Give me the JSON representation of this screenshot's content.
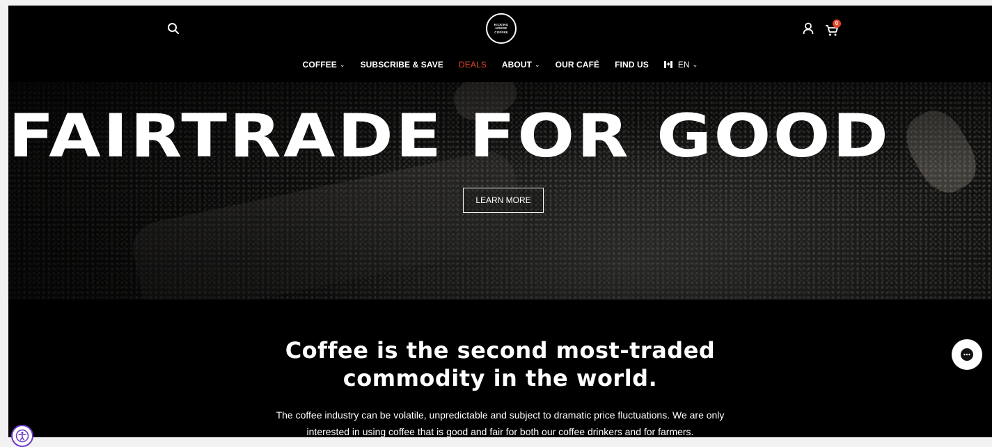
{
  "header": {
    "logo": {
      "line1": "KICKING",
      "line2": "HORSE",
      "line3": "COFFEE"
    },
    "cart_count": "0",
    "nav": {
      "coffee": "COFFEE",
      "subscribe": "SUBSCRIBE & SAVE",
      "deals": "DEALS",
      "about": "ABOUT",
      "cafe": "OUR CAFÉ",
      "find": "FIND US",
      "language": "EN"
    },
    "colors": {
      "accent": "#e8462a",
      "background": "#000000"
    }
  },
  "hero": {
    "title": "FAIRTRADE FOR GOOD",
    "button_label": "LEARN MORE"
  },
  "content": {
    "headline_line1": "Coffee is the second most-traded",
    "headline_line2": "commodity in the world.",
    "body_line1": "The coffee industry can be volatile, unpredictable and subject to dramatic price fluctuations. We are only",
    "body_line2": "interested in using coffee that is good and fair for both our coffee drinkers and for farmers."
  },
  "widgets": {
    "chat_icon": "chat-icon",
    "accessibility_icon": "accessibility-icon"
  }
}
